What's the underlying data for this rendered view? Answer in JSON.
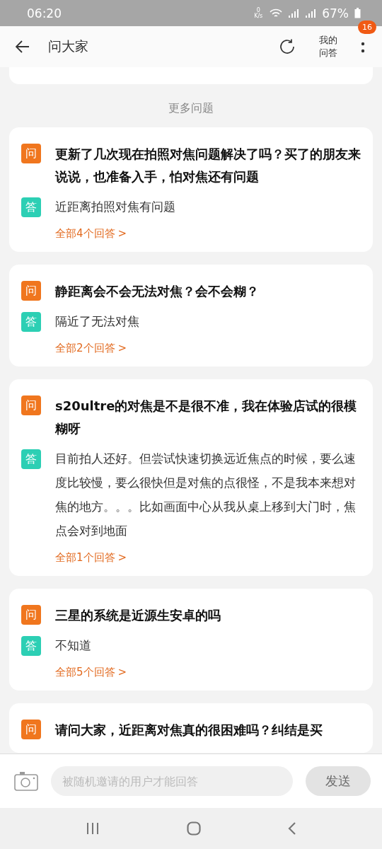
{
  "status_bar": {
    "time": "06:20",
    "net_speed": "0 K/s",
    "battery": "67%"
  },
  "header": {
    "title": "问大家",
    "my_answers": "我的问答",
    "badge": "16"
  },
  "section_title": "更多问题",
  "questions": [
    {
      "q_mark": "问",
      "question": "更新了几次现在拍照对焦问题解决了吗？买了的朋友来说说，也准备入手，怕对焦还有问题",
      "a_mark": "答",
      "answer": "近距离拍照对焦有问题",
      "link": "全部4个回答",
      "chevron": ">"
    },
    {
      "q_mark": "问",
      "question": "静距离会不会无法对焦？会不会糊？",
      "a_mark": "答",
      "answer": "隔近了无法对焦",
      "link": "全部2个回答",
      "chevron": ">"
    },
    {
      "q_mark": "问",
      "question": "s20ultre的对焦是不是很不准，我在体验店试的很模糊呀",
      "a_mark": "答",
      "answer": "目前拍人还好。但尝试快速切换远近焦点的时候，要么速度比较慢，要么很快但是对焦的点很怪，不是我本来想对焦的地方。。。比如画面中心从我从桌上移到大门时，焦点会对到地面",
      "link": "全部1个回答",
      "chevron": ">"
    },
    {
      "q_mark": "问",
      "question": "三星的系统是近源生安卓的吗",
      "a_mark": "答",
      "answer": "不知道",
      "link": "全部5个回答",
      "chevron": ">"
    },
    {
      "q_mark": "问",
      "question": "请问大家，近距离对焦真的很困难吗？纠结是买"
    }
  ],
  "reply_bar": {
    "placeholder": "被随机邀请的用户才能回答",
    "send": "发送",
    "send_disabled": true
  }
}
